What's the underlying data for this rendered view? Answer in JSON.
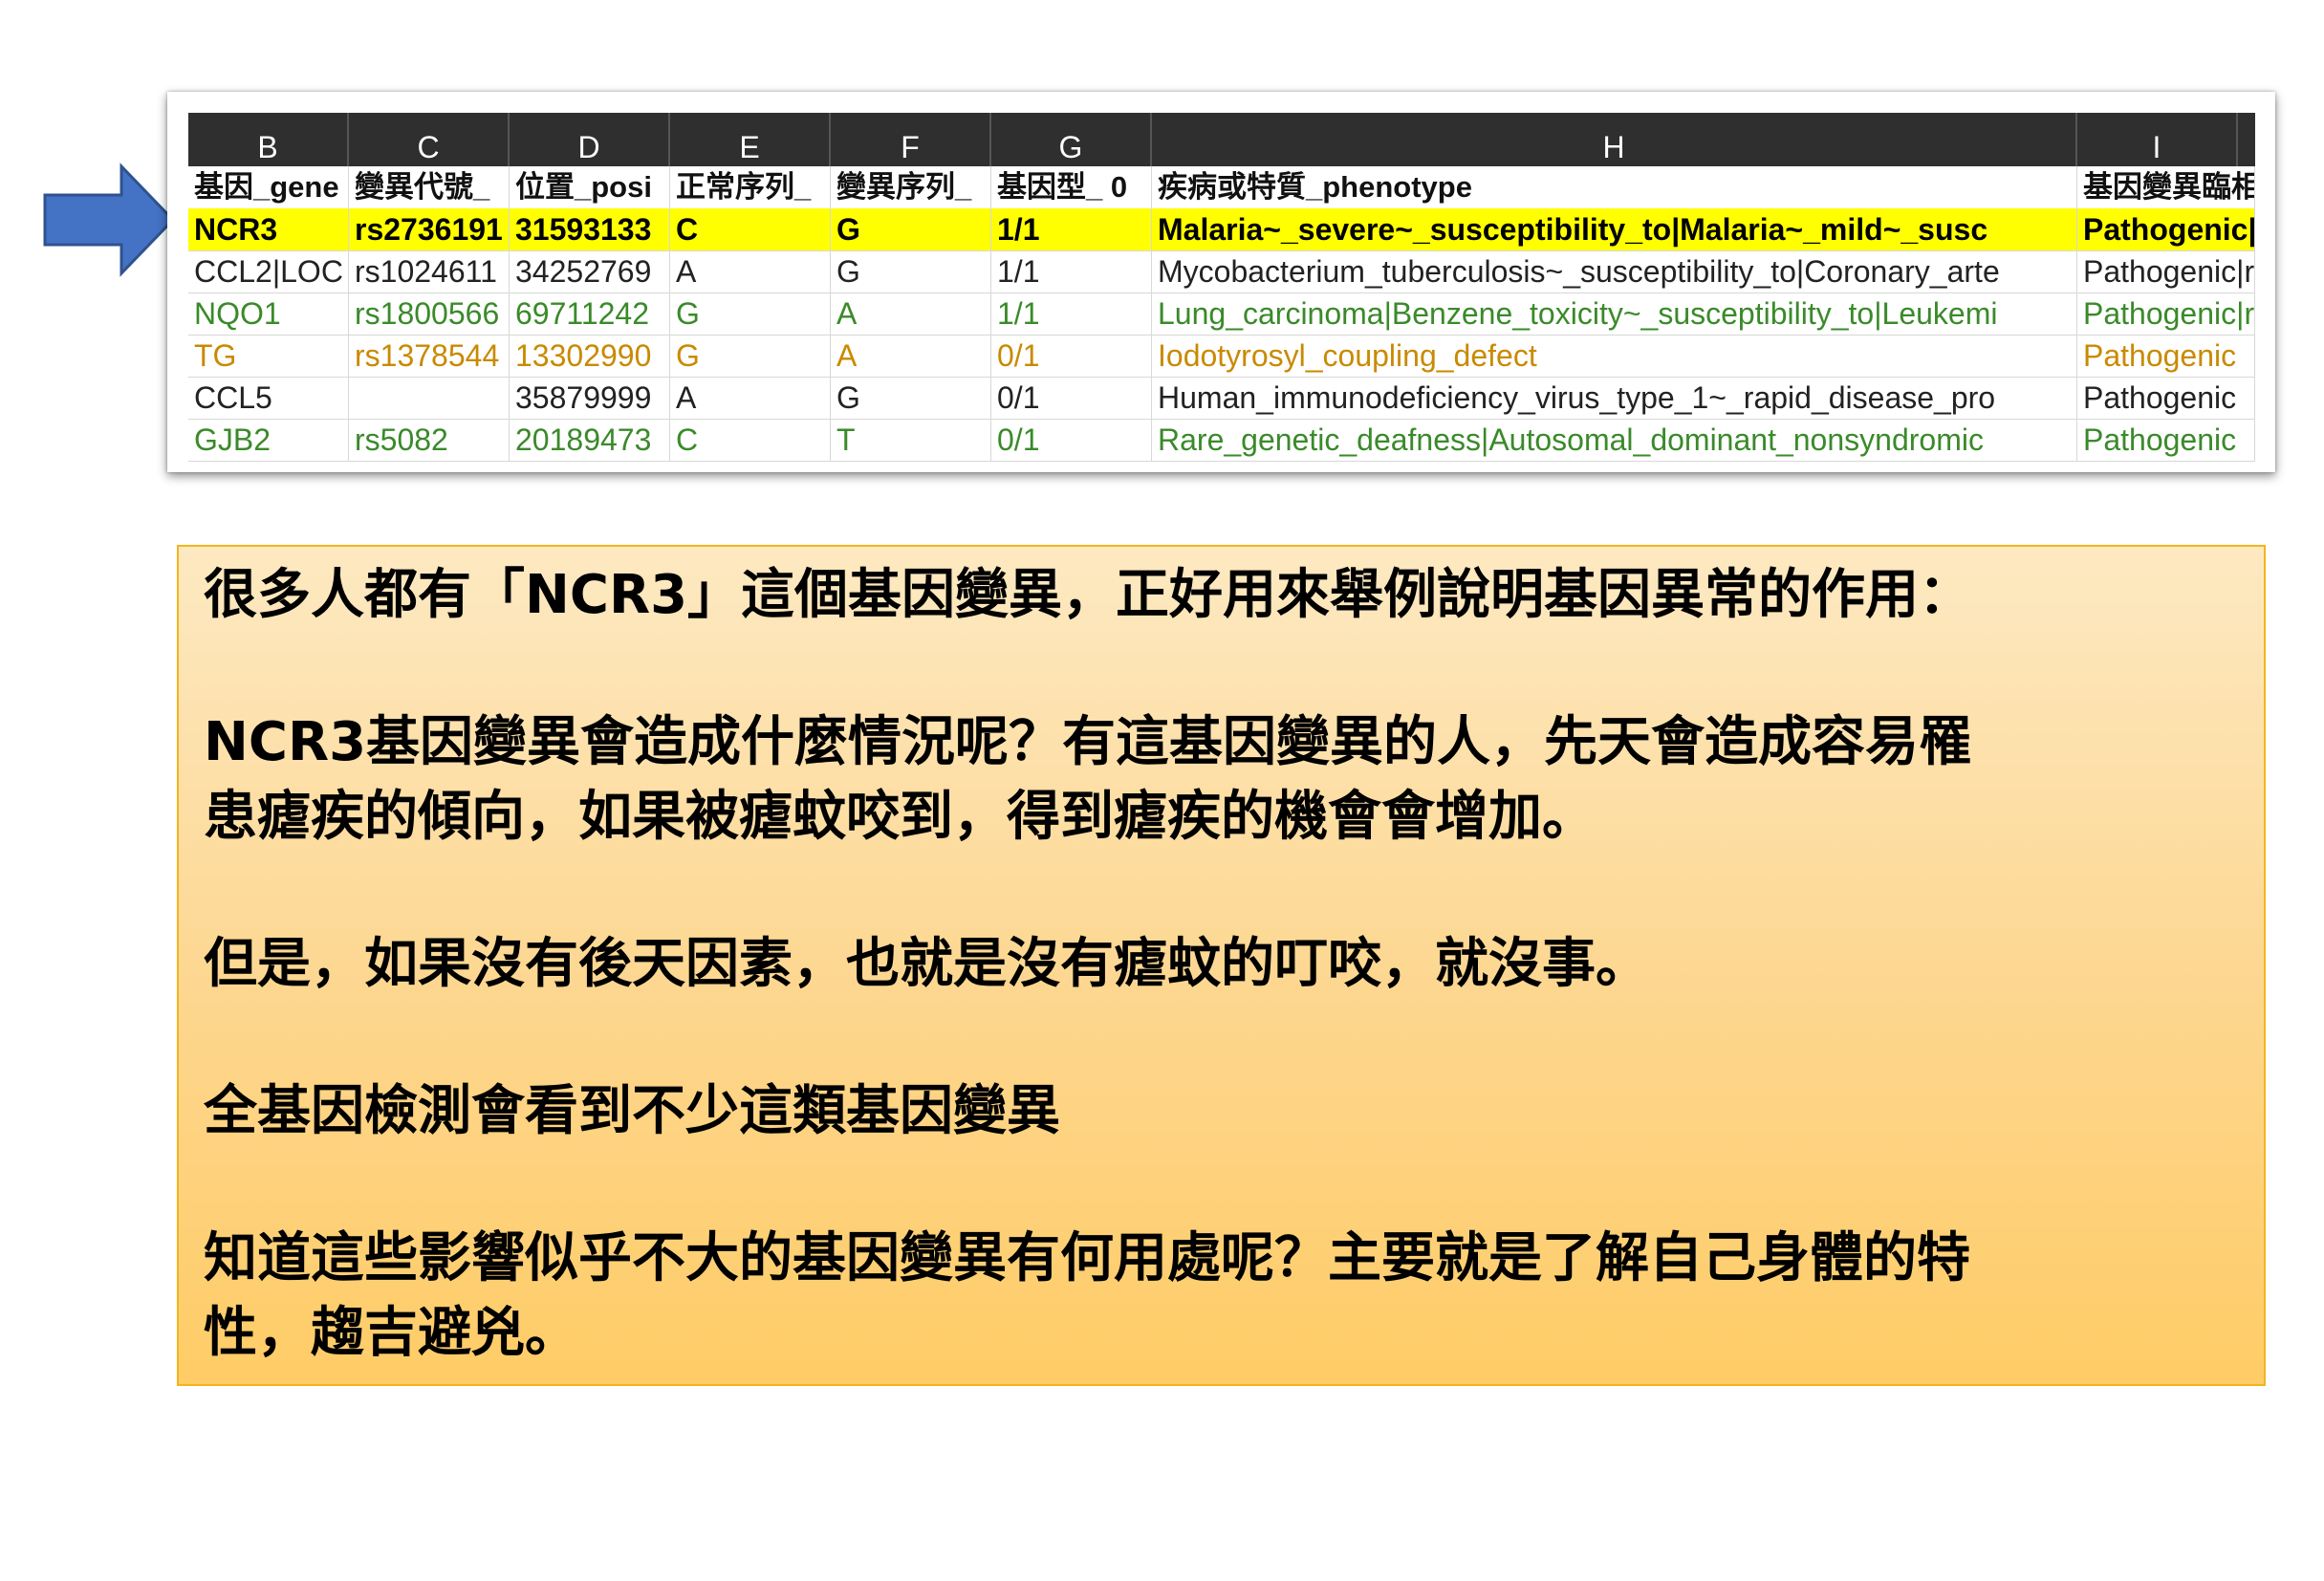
{
  "sheet": {
    "columns": [
      "B",
      "C",
      "D",
      "E",
      "F",
      "G",
      "H",
      "I"
    ],
    "header": [
      "基因_gene",
      "變異代號_",
      "位置_posi",
      "正常序列_",
      "變異序列_",
      "基因型_ 0",
      "疾病或特質_phenotype",
      "基因變異臨相"
    ],
    "rows": [
      [
        "NCR3",
        "rs2736191",
        "31593133",
        "C",
        "G",
        "1/1",
        "Malaria~_severe~_susceptibility_to|Malaria~_mild~_susc",
        "Pathogenic|"
      ],
      [
        "CCL2|LOC",
        "rs1024611",
        "34252769",
        "A",
        "G",
        "1/1",
        "Mycobacterium_tuberculosis~_susceptibility_to|Coronary_arte",
        "Pathogenic|r"
      ],
      [
        "NQO1",
        "rs1800566",
        "69711242",
        "G",
        "A",
        "1/1",
        "Lung_carcinoma|Benzene_toxicity~_susceptibility_to|Leukemi",
        "Pathogenic|r"
      ],
      [
        "TG",
        "rs1378544",
        "13302990",
        "G",
        "A",
        "0/1",
        "Iodotyrosyl_coupling_defect",
        "Pathogenic"
      ],
      [
        "CCL5",
        "",
        "35879999",
        "A",
        "G",
        "0/1",
        "Human_immunodeficiency_virus_type_1~_rapid_disease_pro",
        "Pathogenic"
      ],
      [
        "GJB2",
        "rs5082",
        "20189473",
        "C",
        "T",
        "0/1",
        "Rare_genetic_deafness|Autosomal_dominant_nonsyndromic",
        "Pathogenic"
      ]
    ]
  },
  "note": {
    "p1": "很多人都有「NCR3」這個基因變異，正好用來舉例說明基因異常的作用：",
    "p2a": "NCR3基因變異會造成什麼情況呢？有這基因變異的人，先天會造成容易罹",
    "p2b": "患瘧疾的傾向，如果被瘧蚊咬到，得到瘧疾的機會會增加。",
    "p3": "但是，如果沒有後天因素，也就是沒有瘧蚊的叮咬，就沒事。",
    "p4": "全基因檢測會看到不少這類基因變異",
    "p5a": "知道這些影響似乎不大的基因變異有何用處呢？主要就是了解自己身體的特",
    "p5b": "性，趨吉避兇。"
  },
  "colors": {
    "highlight": "#ffff00",
    "arrow": "#4472c4",
    "note_border": "#f2b51d"
  },
  "icons": {
    "arrow": "right-arrow-icon"
  }
}
